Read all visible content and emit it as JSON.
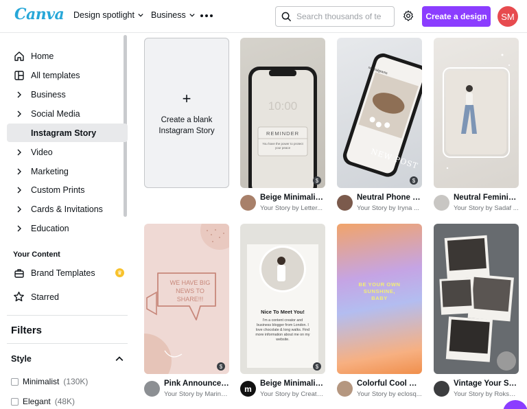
{
  "header": {
    "logo": "Canva",
    "nav": [
      {
        "label": "Design spotlight"
      },
      {
        "label": "Business"
      }
    ],
    "search_placeholder": "Search thousands of te",
    "cta_label": "Create a design",
    "avatar_initials": "SM",
    "brand_color": "#8b3dff",
    "avatar_color": "#e74b4f"
  },
  "sidebar": {
    "items": [
      {
        "label": "Home",
        "icon": "home-icon"
      },
      {
        "label": "All templates",
        "icon": "templates-icon"
      },
      {
        "label": "Business",
        "icon": "chevron-right-icon"
      },
      {
        "label": "Social Media",
        "icon": "chevron-right-icon"
      },
      {
        "label": "Instagram Story",
        "icon": "",
        "active": true
      },
      {
        "label": "Video",
        "icon": "chevron-right-icon"
      },
      {
        "label": "Marketing",
        "icon": "chevron-right-icon"
      },
      {
        "label": "Custom Prints",
        "icon": "chevron-right-icon"
      },
      {
        "label": "Cards & Invitations",
        "icon": "chevron-right-icon"
      },
      {
        "label": "Education",
        "icon": "chevron-right-icon"
      }
    ],
    "your_content_title": "Your Content",
    "content_items": [
      {
        "label": "Brand Templates",
        "icon": "briefcase-icon"
      },
      {
        "label": "Starred",
        "icon": "star-icon"
      }
    ],
    "filters_title": "Filters",
    "style_title": "Style",
    "style_options": [
      {
        "label": "Minimalist",
        "count": "(130K)"
      },
      {
        "label": "Elegant",
        "count": "(48K)"
      }
    ]
  },
  "main": {
    "blank_card": {
      "line1": "Create a blank",
      "line2": "Instagram Story"
    },
    "templates": [
      {
        "title": "Beige Minimalist ...",
        "subtitle": "Your Story by Letter...",
        "paid": true
      },
      {
        "title": "Neutral Phone M...",
        "subtitle": "Your Story by Iryna ...",
        "paid": true
      },
      {
        "title": "Neutral Feminine...",
        "subtitle": "Your Story by Sadaf ...",
        "paid": false
      },
      {
        "title": "Pink Announcem...",
        "subtitle": "Your Story by Marina...",
        "paid": true
      },
      {
        "title": "Beige Minimalist ...",
        "subtitle": "Your Story by Create...",
        "paid": true
      },
      {
        "title": "Colorful Cool Dre...",
        "subtitle": "Your Story by eclosq...",
        "paid": false
      },
      {
        "title": "Vintage Your Stor...",
        "subtitle": "Your Story by Roksol...",
        "paid": false
      }
    ],
    "thumb_text": {
      "phone_time": "10:00",
      "reminder_title": "REMINDER",
      "reminder_body": "You have the power to protect your peace",
      "insta_handle": "neutralgrams",
      "new_post": "NEW POST",
      "big_news": "WE HAVE BIG NEWS TO SHARE!!!",
      "nice_title": "Nice To Meet You!",
      "nice_body": "I'm a content creator and business blogger from London. I love chocolate & long walks. Find more information about me on my website.",
      "sunshine": "BE YOUR OWN SUNSHINE, BABY",
      "creator_initial": "m"
    },
    "dollar_symbol": "$"
  }
}
